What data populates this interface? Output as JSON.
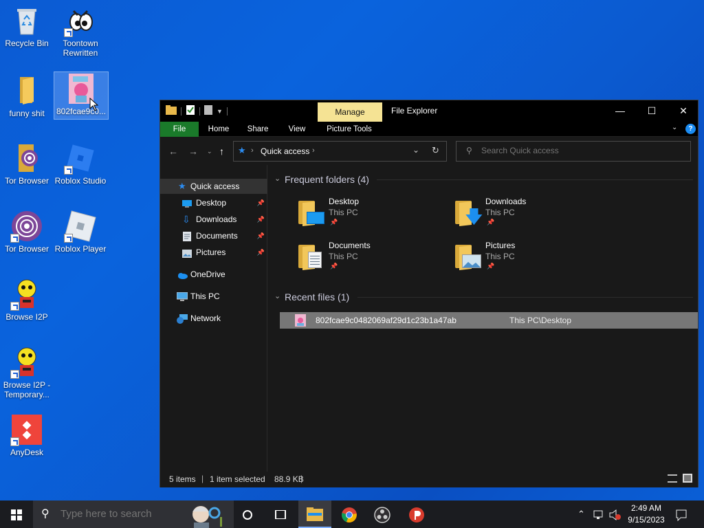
{
  "desktop": {
    "icons": [
      {
        "label": "Recycle Bin"
      },
      {
        "label": "Toontown Rewritten"
      },
      {
        "label": "funny shit"
      },
      {
        "label": "802fcae9c0..."
      },
      {
        "label": "Tor Browser"
      },
      {
        "label": "Roblox Studio"
      },
      {
        "label": "Tor Browser"
      },
      {
        "label": "Roblox Player"
      },
      {
        "label": "Browse I2P"
      },
      {
        "label": "Browse I2P - Temporary..."
      },
      {
        "label": "AnyDesk"
      }
    ]
  },
  "explorer": {
    "title": "File Explorer",
    "contextual_tab": "Manage",
    "ribbon_tabs": [
      "File",
      "Home",
      "Share",
      "View",
      "Picture Tools"
    ],
    "address": {
      "location": "Quick access"
    },
    "search": {
      "placeholder": "Search Quick access"
    },
    "nav": {
      "quick_access": "Quick access",
      "items": [
        {
          "label": "Desktop"
        },
        {
          "label": "Downloads"
        },
        {
          "label": "Documents"
        },
        {
          "label": "Pictures"
        }
      ],
      "onedrive": "OneDrive",
      "this_pc": "This PC",
      "network": "Network"
    },
    "frequent": {
      "header": "Frequent folders (4)",
      "folders": [
        {
          "name": "Desktop",
          "location": "This PC"
        },
        {
          "name": "Downloads",
          "location": "This PC"
        },
        {
          "name": "Documents",
          "location": "This PC"
        },
        {
          "name": "Pictures",
          "location": "This PC"
        }
      ]
    },
    "recent": {
      "header": "Recent files (1)",
      "files": [
        {
          "name": "802fcae9c0482069af29d1c23b1a47ab",
          "location": "This PC\\Desktop"
        }
      ]
    },
    "status": {
      "items": "5 items",
      "selected": "1 item selected",
      "size": "88.9 KB"
    }
  },
  "taskbar": {
    "search_placeholder": "Type here to search",
    "time": "2:49 AM",
    "date": "9/15/2023"
  },
  "colors": {
    "desktop_bg": "#0b5bd3",
    "window_bg": "#191919",
    "manage_tab": "#f5e394",
    "file_tab": "#1a7a2a",
    "accent_blue": "#1b8cf2"
  }
}
